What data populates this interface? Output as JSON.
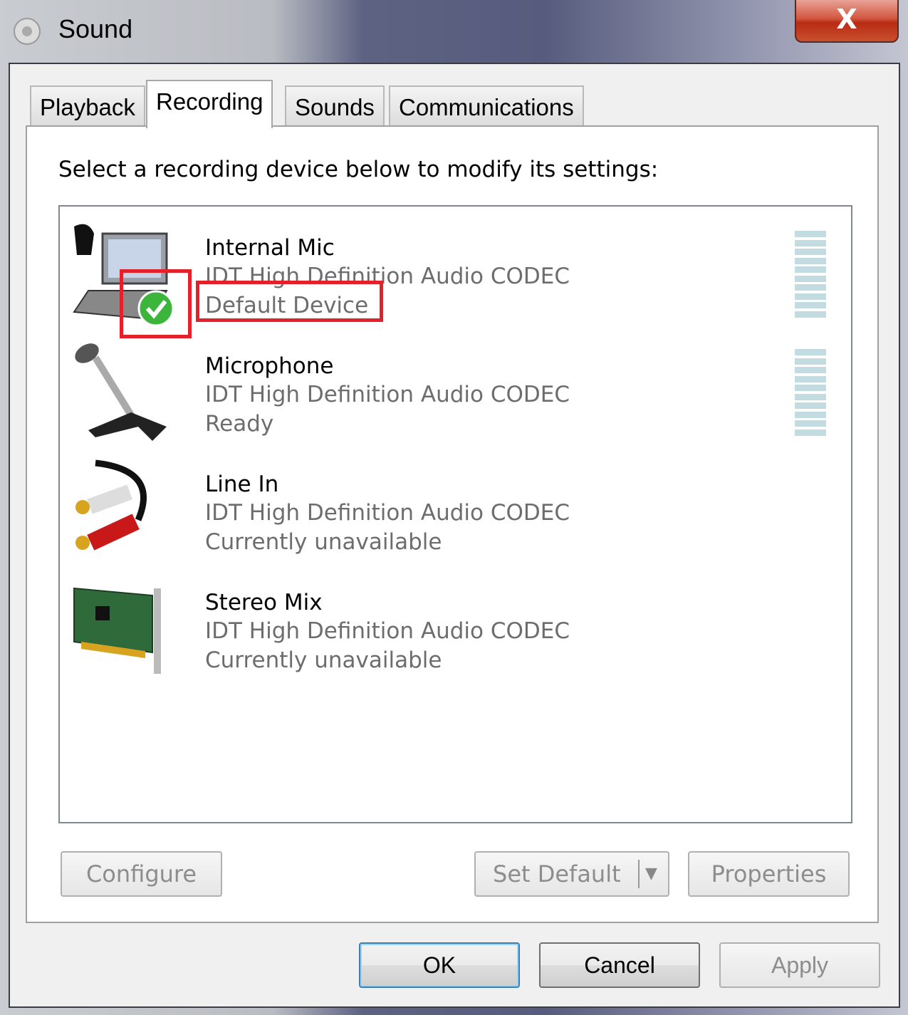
{
  "window": {
    "title": "Sound",
    "close_label": "X"
  },
  "tabs": [
    {
      "label": "Playback"
    },
    {
      "label": "Recording",
      "active": true
    },
    {
      "label": "Sounds"
    },
    {
      "label": "Communications"
    }
  ],
  "instruction": "Select a recording device below to modify its settings:",
  "devices": [
    {
      "name": "Internal Mic",
      "driver": "IDT High Definition Audio CODEC",
      "status": "Default Device",
      "icon": "laptop-mic-icon",
      "default": true,
      "level_meter": true
    },
    {
      "name": "Microphone",
      "driver": "IDT High Definition Audio CODEC",
      "status": "Ready",
      "icon": "microphone-icon",
      "level_meter": true
    },
    {
      "name": "Line In",
      "driver": "IDT High Definition Audio CODEC",
      "status": "Currently unavailable",
      "icon": "rca-cable-icon"
    },
    {
      "name": "Stereo Mix",
      "driver": "IDT High Definition Audio CODEC",
      "status": "Currently unavailable",
      "icon": "sound-card-icon"
    }
  ],
  "buttons": {
    "configure": "Configure",
    "set_default": "Set Default",
    "properties": "Properties",
    "ok": "OK",
    "cancel": "Cancel",
    "apply": "Apply"
  },
  "colors": {
    "highlight": "#e3212b",
    "meter": "#c3dce2"
  }
}
